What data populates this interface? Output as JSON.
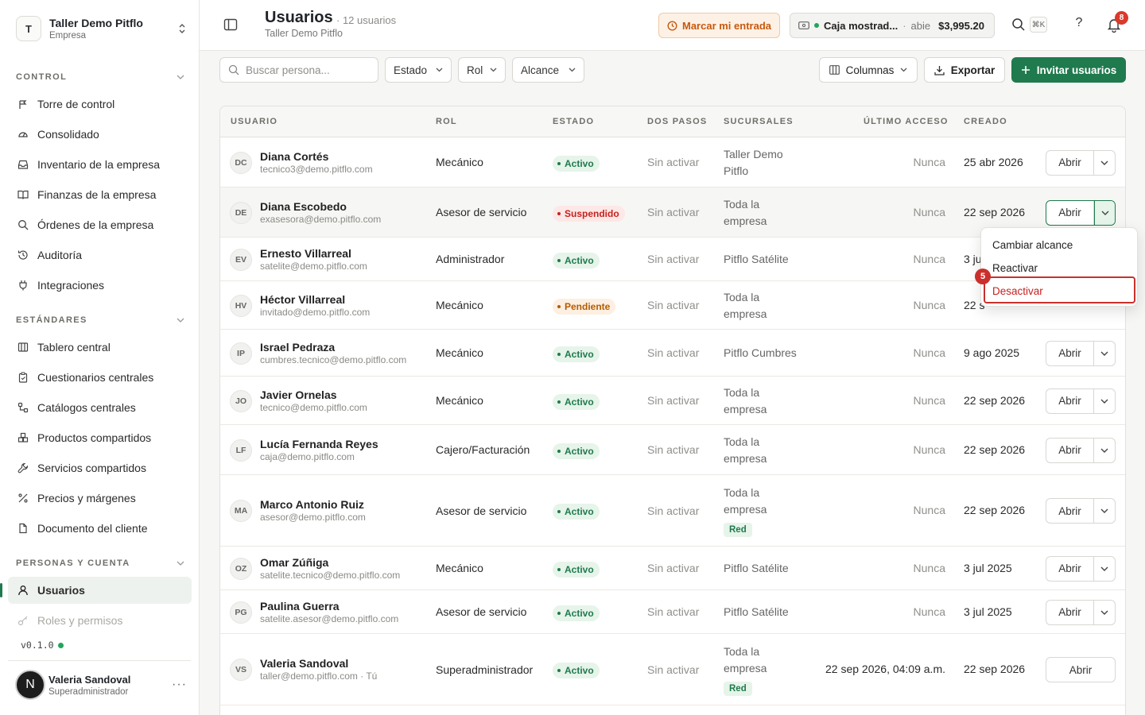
{
  "org": {
    "initial": "T",
    "name": "Taller Demo Pitflo",
    "type": "Empresa"
  },
  "sidebar": {
    "sections": [
      {
        "label": "CONTROL",
        "items": [
          "Torre de control",
          "Consolidado",
          "Inventario de la empresa",
          "Finanzas de la empresa",
          "Órdenes de la empresa",
          "Auditoría",
          "Integraciones"
        ]
      },
      {
        "label": "ESTÁNDARES",
        "items": [
          "Tablero central",
          "Cuestionarios centrales",
          "Catálogos centrales",
          "Productos compartidos",
          "Servicios compartidos",
          "Precios y márgenes",
          "Documento del cliente"
        ]
      },
      {
        "label": "PERSONAS Y CUENTA",
        "items": [
          "Usuarios",
          "Roles y permisos"
        ]
      }
    ],
    "version": "v0.1.0",
    "user": {
      "initial": "N",
      "name": "Valeria Sandoval",
      "role": "Superadministrador",
      "more": "···"
    }
  },
  "header": {
    "title": "Usuarios",
    "count": "· 12 usuarios",
    "subtitle": "Taller Demo Pitflo",
    "clock_in": "Marcar mi entrada",
    "register": {
      "name": "Caja mostrad...",
      "sep": "·",
      "state": "abie",
      "amount": "$3,995.20"
    },
    "shortcut": "⌘K",
    "help": "?",
    "notifications": "8"
  },
  "toolbar": {
    "search_placeholder": "Buscar persona...",
    "filter_status": "Estado",
    "filter_role": "Rol",
    "filter_scope": "Alcance",
    "columns": "Columnas",
    "export": "Exportar",
    "invite": "Invitar usuarios"
  },
  "table": {
    "headers": [
      "USUARIO",
      "ROL",
      "ESTADO",
      "DOS PASOS",
      "SUCURSALES",
      "ÚLTIMO ACCESO",
      "CREADO"
    ],
    "open_label": "Abrir",
    "rows": [
      {
        "initials": "DC",
        "name": "Diana Cortés",
        "email": "tecnico3@demo.pitflo.com",
        "role": "Mecánico",
        "status": "Activo",
        "two_step": "Sin activar",
        "branch_l1": "Taller Demo",
        "branch_l2": "Pitflo",
        "branch_tag": "",
        "last": "Nunca",
        "created": "25 abr 2026"
      },
      {
        "initials": "DE",
        "name": "Diana Escobedo",
        "email": "exasesora@demo.pitflo.com",
        "role": "Asesor de servicio",
        "status": "Suspendido",
        "two_step": "Sin activar",
        "branch_l1": "Toda la",
        "branch_l2": "empresa",
        "branch_tag": "",
        "last": "Nunca",
        "created": "22 sep 2026"
      },
      {
        "initials": "EV",
        "name": "Ernesto Villarreal",
        "email": "satelite@demo.pitflo.com",
        "role": "Administrador",
        "status": "Activo",
        "two_step": "Sin activar",
        "branch_l1": "Pitflo Satélite",
        "branch_l2": "",
        "branch_tag": "",
        "last": "Nunca",
        "created": "3 ju"
      },
      {
        "initials": "HV",
        "name": "Héctor Villarreal",
        "email": "invitado@demo.pitflo.com",
        "role": "Mecánico",
        "status": "Pendiente",
        "two_step": "Sin activar",
        "branch_l1": "Toda la",
        "branch_l2": "empresa",
        "branch_tag": "",
        "last": "Nunca",
        "created": "22 s"
      },
      {
        "initials": "IP",
        "name": "Israel Pedraza",
        "email": "cumbres.tecnico@demo.pitflo.com",
        "role": "Mecánico",
        "status": "Activo",
        "two_step": "Sin activar",
        "branch_l1": "Pitflo Cumbres",
        "branch_l2": "",
        "branch_tag": "",
        "last": "Nunca",
        "created": "9 ago 2025"
      },
      {
        "initials": "JO",
        "name": "Javier Ornelas",
        "email": "tecnico@demo.pitflo.com",
        "role": "Mecánico",
        "status": "Activo",
        "two_step": "Sin activar",
        "branch_l1": "Toda la",
        "branch_l2": "empresa",
        "branch_tag": "",
        "last": "Nunca",
        "created": "22 sep 2026"
      },
      {
        "initials": "LF",
        "name": "Lucía Fernanda Reyes",
        "email": "caja@demo.pitflo.com",
        "role": "Cajero/Facturación",
        "status": "Activo",
        "two_step": "Sin activar",
        "branch_l1": "Toda la",
        "branch_l2": "empresa",
        "branch_tag": "",
        "last": "Nunca",
        "created": "22 sep 2026"
      },
      {
        "initials": "MA",
        "name": "Marco Antonio Ruiz",
        "email": "asesor@demo.pitflo.com",
        "role": "Asesor de servicio",
        "status": "Activo",
        "two_step": "Sin activar",
        "branch_l1": "Toda la",
        "branch_l2": "empresa",
        "branch_tag": "Red",
        "last": "Nunca",
        "created": "22 sep 2026"
      },
      {
        "initials": "OZ",
        "name": "Omar Zúñiga",
        "email": "satelite.tecnico@demo.pitflo.com",
        "role": "Mecánico",
        "status": "Activo",
        "two_step": "Sin activar",
        "branch_l1": "Pitflo Satélite",
        "branch_l2": "",
        "branch_tag": "",
        "last": "Nunca",
        "created": "3 jul 2025"
      },
      {
        "initials": "PG",
        "name": "Paulina Guerra",
        "email": "satelite.asesor@demo.pitflo.com",
        "role": "Asesor de servicio",
        "status": "Activo",
        "two_step": "Sin activar",
        "branch_l1": "Pitflo Satélite",
        "branch_l2": "",
        "branch_tag": "",
        "last": "Nunca",
        "created": "3 jul 2025"
      },
      {
        "initials": "VS",
        "name": "Valeria Sandoval",
        "email": "taller@demo.pitflo.com · Tú",
        "role": "Superadministrador",
        "status": "Activo",
        "two_step": "Sin activar",
        "branch_l1": "Toda la",
        "branch_l2": "empresa",
        "branch_tag": "Red",
        "last": "22 sep 2026, 04:09 a.m.",
        "created": "22 sep 2026"
      }
    ]
  },
  "row_menu": {
    "items": [
      "Cambiar alcance",
      "Reactivar",
      "Desactivar"
    ],
    "step": "5"
  },
  "colors": {
    "accent": "#1f7a4d",
    "danger": "#c5221f",
    "warning": "#c8590c"
  }
}
